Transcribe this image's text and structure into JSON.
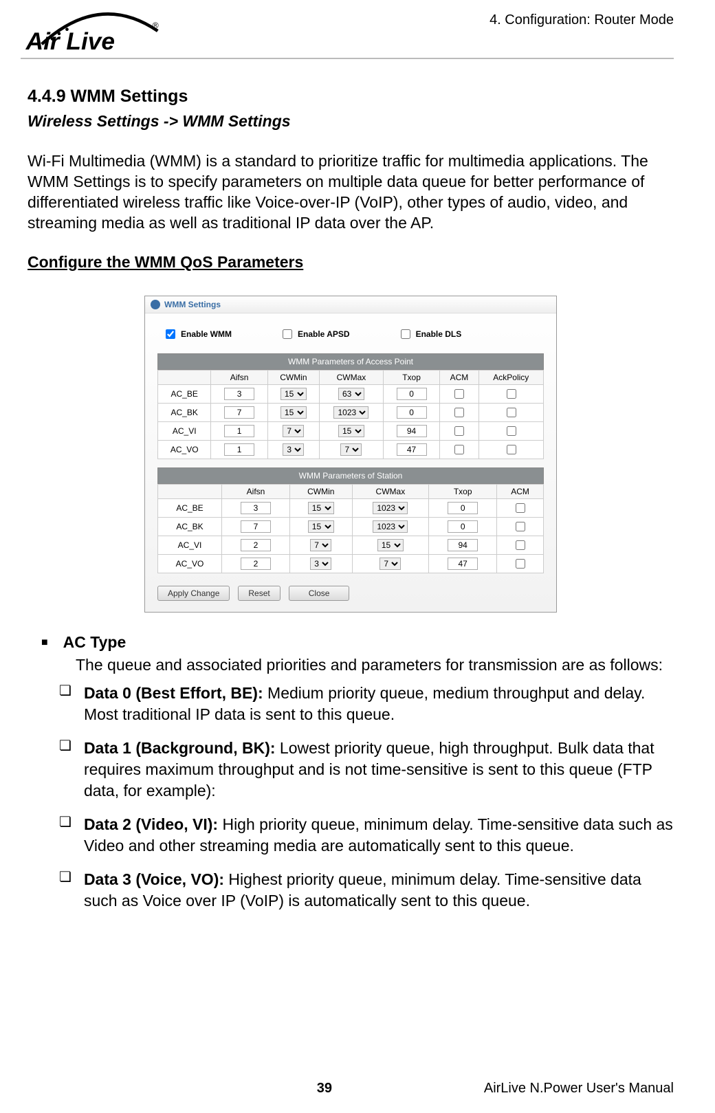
{
  "header": {
    "breadcrumb": "4. Configuration: Router Mode"
  },
  "logo": {
    "text": "Air Live",
    "reg": "®"
  },
  "section": {
    "num_title": "4.4.9 WMM Settings",
    "path": "Wireless Settings -> WMM Settings",
    "para": "Wi-Fi Multimedia (WMM) is a standard to prioritize traffic for multimedia applications.    The WMM Settings is to specify parameters on multiple data queue for better performance of differentiated wireless traffic like Voice-over-IP (VoIP), other types of audio, video, and streaming media as well as traditional IP data over the AP.",
    "cfg_title": "Configure the WMM QoS Parameters"
  },
  "screenshot": {
    "title": "WMM Settings",
    "checks": {
      "wmm": "Enable WMM",
      "apsd": "Enable APSD",
      "dls": "Enable DLS"
    },
    "ap": {
      "caption": "WMM Parameters of Access Point",
      "head": [
        "",
        "Aifsn",
        "CWMin",
        "CWMax",
        "Txop",
        "ACM",
        "AckPolicy"
      ],
      "rows": [
        {
          "name": "AC_BE",
          "aifsn": "3",
          "cwmin": "15",
          "cwmax": "63",
          "txop": "0"
        },
        {
          "name": "AC_BK",
          "aifsn": "7",
          "cwmin": "15",
          "cwmax": "1023",
          "txop": "0"
        },
        {
          "name": "AC_VI",
          "aifsn": "1",
          "cwmin": "7",
          "cwmax": "15",
          "txop": "94"
        },
        {
          "name": "AC_VO",
          "aifsn": "1",
          "cwmin": "3",
          "cwmax": "7",
          "txop": "47"
        }
      ]
    },
    "sta": {
      "caption": "WMM Parameters of Station",
      "head": [
        "",
        "Aifsn",
        "CWMin",
        "CWMax",
        "Txop",
        "ACM"
      ],
      "rows": [
        {
          "name": "AC_BE",
          "aifsn": "3",
          "cwmin": "15",
          "cwmax": "1023",
          "txop": "0"
        },
        {
          "name": "AC_BK",
          "aifsn": "7",
          "cwmin": "15",
          "cwmax": "1023",
          "txop": "0"
        },
        {
          "name": "AC_VI",
          "aifsn": "2",
          "cwmin": "7",
          "cwmax": "15",
          "txop": "94"
        },
        {
          "name": "AC_VO",
          "aifsn": "2",
          "cwmin": "3",
          "cwmax": "7",
          "txop": "47"
        }
      ]
    },
    "buttons": {
      "apply": "Apply Change",
      "reset": "Reset",
      "close": "Close"
    }
  },
  "ac_type": {
    "title": "AC Type",
    "intro": "The queue and associated priorities and parameters for transmission are as follows:",
    "items": [
      {
        "lead": "Data 0 (Best Effort, BE):",
        "body": " Medium priority queue, medium throughput and delay. Most traditional IP data is sent to this queue."
      },
      {
        "lead": "Data 1 (Background, BK):",
        "body": " Lowest priority queue, high throughput. Bulk data that requires maximum throughput and is not time-sensitive is sent to this queue (FTP data, for example):"
      },
      {
        "lead": "Data 2 (Video, VI):",
        "body": " High priority queue, minimum delay. Time-sensitive data such as Video and other streaming media are automatically sent to this queue."
      },
      {
        "lead": "Data 3 (Voice, VO):",
        "body": " Highest priority queue, minimum delay. Time-sensitive data such as Voice over IP (VoIP) is automatically sent to this queue."
      }
    ]
  },
  "footer": {
    "page": "39",
    "manual": "AirLive N.Power User's Manual"
  }
}
